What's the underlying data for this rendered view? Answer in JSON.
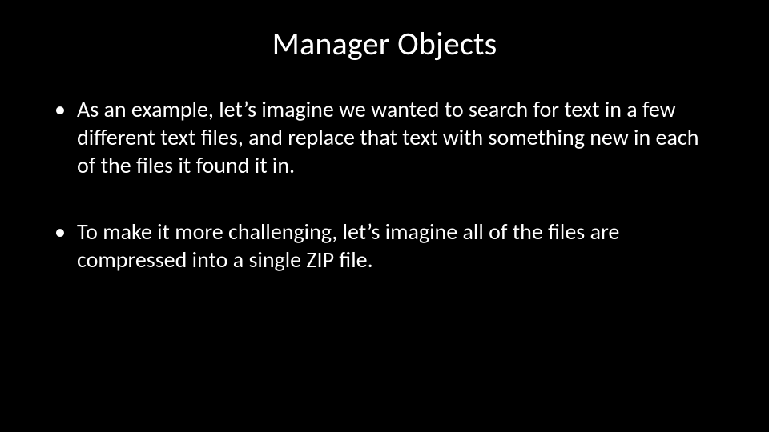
{
  "slide": {
    "title": "Manager Objects",
    "bullets": [
      "As an example, let’s imagine we wanted to search for text in a few different text files, and replace that text with something new in each of the files it found it in.",
      "To make it more challenging, let’s imagine all of the files are compressed into a single ZIP file."
    ]
  }
}
